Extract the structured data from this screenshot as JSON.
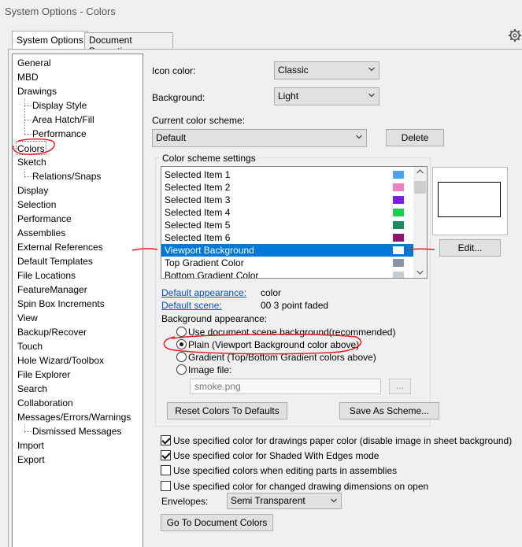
{
  "window": {
    "title": "System Options - Colors"
  },
  "tabs": [
    {
      "label": "System Options",
      "active": true
    },
    {
      "label": "Document Properties",
      "active": false
    }
  ],
  "tree": [
    "General",
    "MBD",
    "Drawings",
    "Display Style",
    "Area Hatch/Fill",
    "Performance",
    "Colors",
    "Sketch",
    "Relations/Snaps",
    "Display",
    "Selection",
    "Performance",
    "Assemblies",
    "External References",
    "Default Templates",
    "File Locations",
    "FeatureManager",
    "Spin Box Increments",
    "View",
    "Backup/Recover",
    "Touch",
    "Hole Wizard/Toolbox",
    "File Explorer",
    "Search",
    "Collaboration",
    "Messages/Errors/Warnings",
    "Dismissed Messages",
    "Import",
    "Export"
  ],
  "icon_color": {
    "label": "Icon color:",
    "value": "Classic"
  },
  "background": {
    "label": "Background:",
    "value": "Light"
  },
  "scheme": {
    "label": "Current color scheme:",
    "value": "Default",
    "delete_label": "Delete"
  },
  "settings": {
    "title": "Color scheme settings",
    "items": [
      {
        "label": "Selected Item 1",
        "color": "#4aa3f0"
      },
      {
        "label": "Selected Item 2",
        "color": "#ee7fc0"
      },
      {
        "label": "Selected Item 3",
        "color": "#7b1fe0"
      },
      {
        "label": "Selected Item 4",
        "color": "#1ccf4a"
      },
      {
        "label": "Selected Item 5",
        "color": "#1d8a62"
      },
      {
        "label": "Selected Item 6",
        "color": "#8e1670"
      },
      {
        "label": "Viewport Background",
        "color": "#ffffff"
      },
      {
        "label": "Top Gradient Color",
        "color": "#8a93a5"
      },
      {
        "label": "Bottom Gradient Color",
        "color": "#c7cbd2"
      }
    ],
    "edit_label": "Edit..."
  },
  "default_appearance": {
    "label": "Default appearance:",
    "value": "color"
  },
  "default_scene": {
    "label": "Default scene:",
    "value": "00 3 point faded"
  },
  "bg_appearance": {
    "label": "Background appearance:",
    "options": [
      "Use document scene background(recommended)",
      "Plain (Viewport Background color above)",
      "Gradient (Top/Bottom Gradient colors above)",
      "Image file:"
    ],
    "image_file": "smoke.png",
    "browse_label": "..."
  },
  "reset_label": "Reset Colors To Defaults",
  "save_label": "Save As Scheme...",
  "checks": [
    "Use specified color for drawings paper color (disable image in sheet background)",
    "Use specified color for Shaded With Edges mode",
    "Use specified colors when editing parts in assemblies",
    "Use specified color for changed drawing dimensions on open"
  ],
  "envelopes": {
    "label": "Envelopes:",
    "value": "Semi Transparent"
  },
  "goto_label": "Go To Document Colors"
}
